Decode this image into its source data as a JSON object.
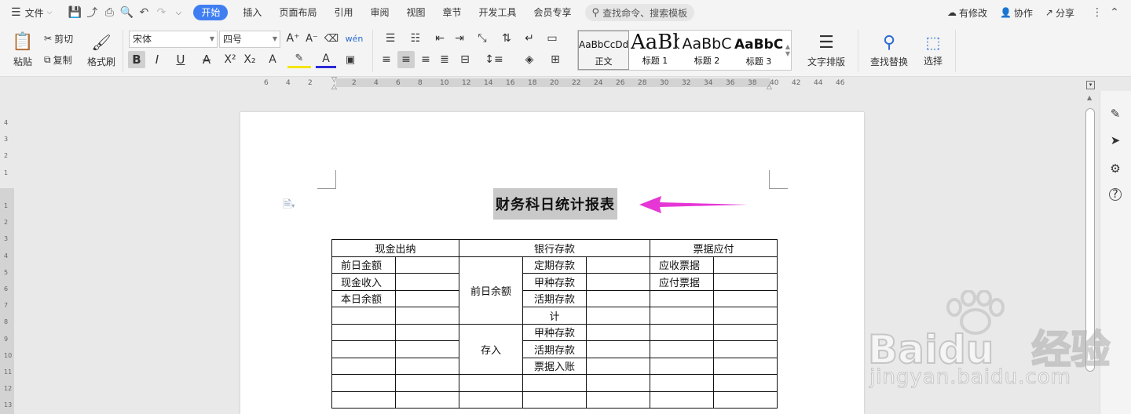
{
  "menubar": {
    "file_label": "文件",
    "tabs": [
      "开始",
      "插入",
      "页面布局",
      "引用",
      "审阅",
      "视图",
      "章节",
      "开发工具",
      "会员专享"
    ],
    "search_placeholder": "查找命令、搜索模板",
    "modified_label": "有修改",
    "collab_label": "协作",
    "share_label": "分享"
  },
  "ribbon": {
    "paste_label": "粘贴",
    "cut_label": "剪切",
    "copy_label": "复制",
    "format_painter_label": "格式刷",
    "font_name": "宋体",
    "font_size": "四号",
    "styles": [
      {
        "preview": "AaBbCcDd",
        "label": "正文"
      },
      {
        "preview": "AaBb",
        "label": "标题 1"
      },
      {
        "preview": "AaBbC",
        "label": "标题 2"
      },
      {
        "preview": "AaBbC",
        "label": "标题 3"
      }
    ],
    "text_layout_label": "文字排版",
    "find_replace_label": "查找替换",
    "select_label": "选择"
  },
  "ruler": {
    "h_ticks": [
      "6",
      "4",
      "2",
      "",
      "2",
      "4",
      "6",
      "8",
      "10",
      "12",
      "14",
      "16",
      "18",
      "20",
      "22",
      "24",
      "26",
      "28",
      "30",
      "32",
      "34",
      "36",
      "38",
      "40",
      "42",
      "44",
      "46"
    ],
    "v_ticks": [
      "4",
      "3",
      "2",
      "1",
      "",
      "1",
      "2",
      "3",
      "4",
      "5",
      "6",
      "7",
      "8",
      "9",
      "10",
      "11",
      "12",
      "13"
    ]
  },
  "document": {
    "title": "财务科日统计报表",
    "table": {
      "headers": [
        "现金出纳",
        "银行存款",
        "票据应付"
      ],
      "cash_labels": [
        "前日金额",
        "现金收入",
        "本日余额"
      ],
      "bank_group_1": "前日余额",
      "bank_group_2": "存入",
      "bank_items_1": [
        "定期存款",
        "甲种存款",
        "活期存款",
        "计"
      ],
      "bank_items_2": [
        "甲种存款",
        "活期存款",
        "票据入账"
      ],
      "bill_labels": [
        "应收票据",
        "应付票据"
      ]
    }
  },
  "watermark": {
    "brand": "Baidu",
    "brand_cn": "经验",
    "url": "jingyan.baidu.com"
  },
  "colors": {
    "accent": "#3f7ef1",
    "arrow": "#e636d6"
  }
}
